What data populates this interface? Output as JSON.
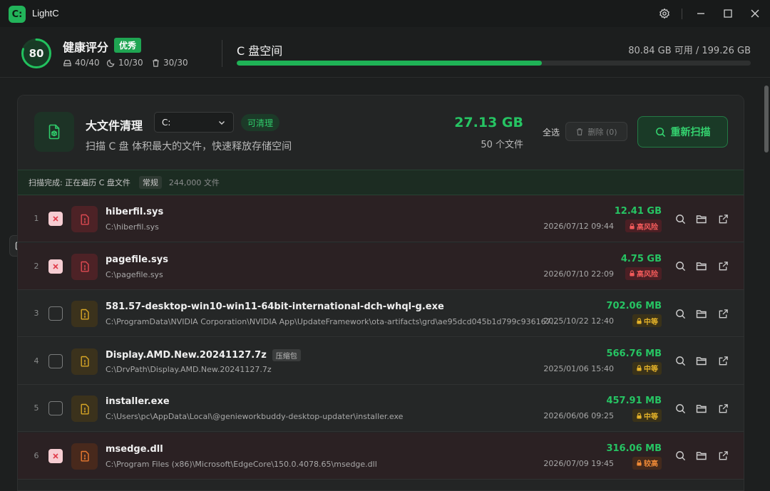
{
  "app": {
    "title": "LightC",
    "logo_text": "C:"
  },
  "health": {
    "score": "80",
    "score_fraction": 0.8,
    "title": "健康评分",
    "badge": "优秀",
    "stats": [
      {
        "icon": "disk-icon",
        "value": "40/40"
      },
      {
        "icon": "moon-icon",
        "value": "10/30"
      },
      {
        "icon": "trash-icon",
        "value": "30/30"
      }
    ]
  },
  "disk": {
    "title": "C 盘空间",
    "space_text": "80.84 GB 可用 / 199.26 GB",
    "used_fraction": 0.594
  },
  "module": {
    "title": "大文件清理",
    "drive_value": "C:",
    "clean_badge": "可清理",
    "description": "扫描 C 盘 体积最大的文件，快速释放存储空间",
    "total_size": "27.13 GB",
    "total_count": "50 个文件",
    "select_all": "全选",
    "delete_label": "删除 (0)",
    "rescan_label": "重新扫描"
  },
  "scan": {
    "status": "扫描完成: 正在遍历 C 盘文件",
    "tag": "常规",
    "count": "244,000 文件"
  },
  "colors": {
    "accent": "#26c463",
    "risk_high": "#f25a5a",
    "risk_mid": "#e4b229",
    "risk_elevated": "#f08a36"
  },
  "files": [
    {
      "num": "1",
      "checked": true,
      "risk": "high",
      "name": "hiberfil.sys",
      "tag": "",
      "path": "C:\\hiberfil.sys",
      "size": "12.41 GB",
      "date": "2026/07/12 09:44",
      "risk_label": "高风险"
    },
    {
      "num": "2",
      "checked": true,
      "risk": "high",
      "name": "pagefile.sys",
      "tag": "",
      "path": "C:\\pagefile.sys",
      "size": "4.75 GB",
      "date": "2026/07/10 22:09",
      "risk_label": "高风险"
    },
    {
      "num": "3",
      "checked": false,
      "risk": "mid",
      "name": "581.57-desktop-win10-win11-64bit-international-dch-whql-g.exe",
      "tag": "",
      "path": "C:\\ProgramData\\NVIDIA Corporation\\NVIDIA App\\UpdateFramework\\ota-artifacts\\grd\\ae95dcd045b1d799c9361673d...",
      "size": "702.06 MB",
      "date": "2025/10/22 12:40",
      "risk_label": "中等"
    },
    {
      "num": "4",
      "checked": false,
      "risk": "mid",
      "name": "Display.AMD.New.20241127.7z",
      "tag": "压缩包",
      "path": "C:\\DrvPath\\Display.AMD.New.20241127.7z",
      "size": "566.76 MB",
      "date": "2025/01/06 15:40",
      "risk_label": "中等"
    },
    {
      "num": "5",
      "checked": false,
      "risk": "mid",
      "name": "installer.exe",
      "tag": "",
      "path": "C:\\Users\\pc\\AppData\\Local\\@genieworkbuddy-desktop-updater\\installer.exe",
      "size": "457.91 MB",
      "date": "2026/06/06 09:25",
      "risk_label": "中等"
    },
    {
      "num": "6",
      "checked": true,
      "risk": "elev",
      "name": "msedge.dll",
      "tag": "",
      "path": "C:\\Program Files (x86)\\Microsoft\\EdgeCore\\150.0.4078.65\\msedge.dll",
      "size": "316.06 MB",
      "date": "2026/07/09 19:45",
      "risk_label": "较高"
    }
  ]
}
